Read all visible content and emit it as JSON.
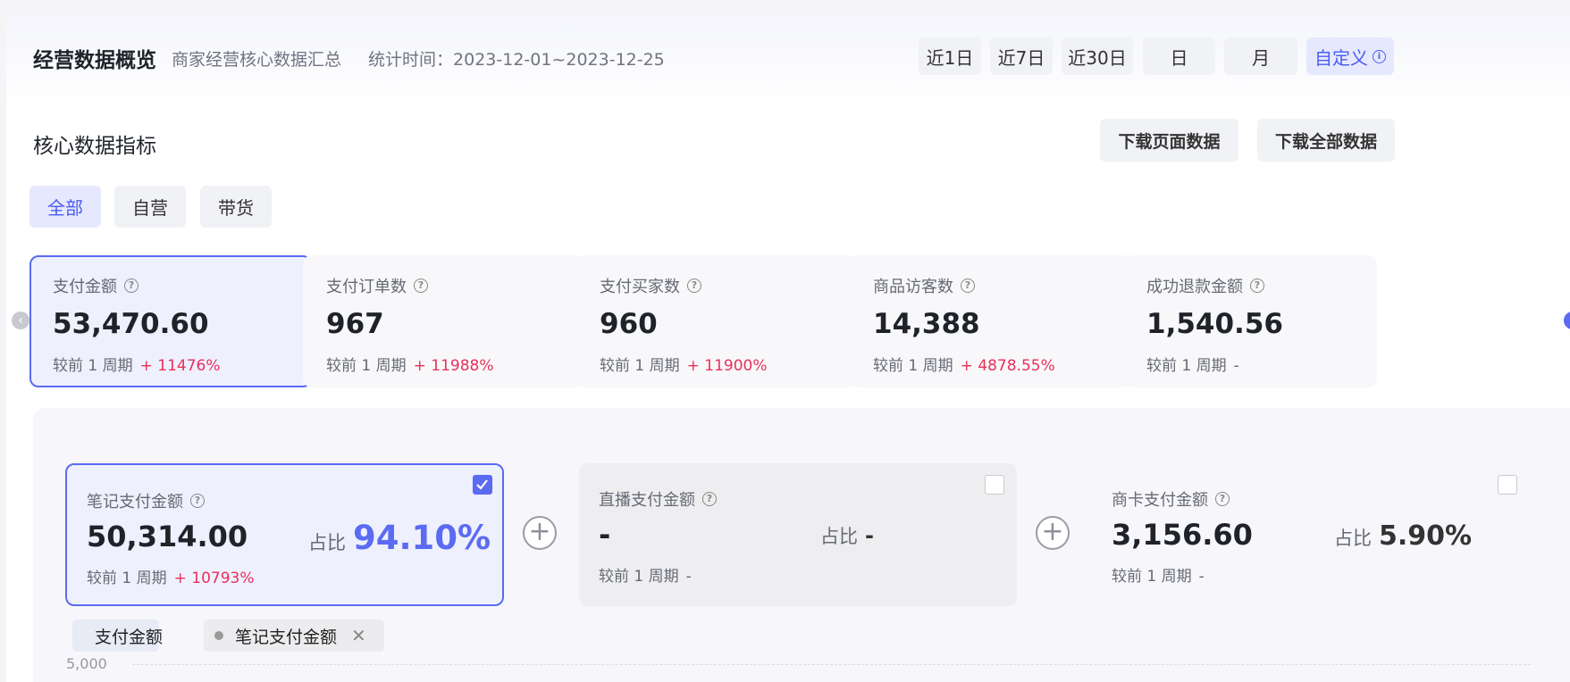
{
  "header": {
    "title": "经营数据概览",
    "subtitle": "商家经营核心数据汇总",
    "time_label": "统计时间：",
    "time_range": "2023-12-01~2023-12-25",
    "date_buttons": [
      "近1日",
      "近7日",
      "近30日",
      "日",
      "月",
      "自定义"
    ],
    "active_date_button": "自定义"
  },
  "section": {
    "title": "核心数据指标",
    "download_page": "下载页面数据",
    "download_all": "下载全部数据"
  },
  "tabs": {
    "items": [
      "全部",
      "自营",
      "带货"
    ],
    "active": "全部"
  },
  "compare_label": "较前 1 周期",
  "metrics": [
    {
      "label": "支付金额",
      "value": "53,470.60",
      "change": "+ 11476%",
      "selected": true
    },
    {
      "label": "支付订单数",
      "value": "967",
      "change": "+ 11988%"
    },
    {
      "label": "支付买家数",
      "value": "960",
      "change": "+ 11900%"
    },
    {
      "label": "商品访客数",
      "value": "14,388",
      "change": "+ 4878.55%"
    },
    {
      "label": "成功退款金额",
      "value": "1,540.56",
      "change": "-"
    }
  ],
  "breakdown": {
    "ratio_label": "占比",
    "items": [
      {
        "label": "笔记支付金额",
        "value": "50,314.00",
        "ratio": "94.10%",
        "change": "+ 10793%",
        "checked": true
      },
      {
        "label": "直播支付金额",
        "value": "-",
        "ratio": "-",
        "change": "-",
        "checked": false
      },
      {
        "label": "商卡支付金额",
        "value": "3,156.60",
        "ratio": "5.90%",
        "change": "-",
        "checked": false
      }
    ]
  },
  "legend": {
    "items": [
      {
        "label": "支付金额",
        "color": "#4a5cf0"
      },
      {
        "label": "笔记支付金额",
        "color": "#999999",
        "removable": true
      }
    ]
  },
  "chart_data": {
    "type": "line",
    "y_ticks": [
      "5,000"
    ],
    "series": [
      {
        "name": "支付金额",
        "values": []
      },
      {
        "name": "笔记支付金额",
        "values": []
      }
    ]
  },
  "colors": {
    "accent": "#5b6bf2",
    "up": "#e8305a"
  }
}
